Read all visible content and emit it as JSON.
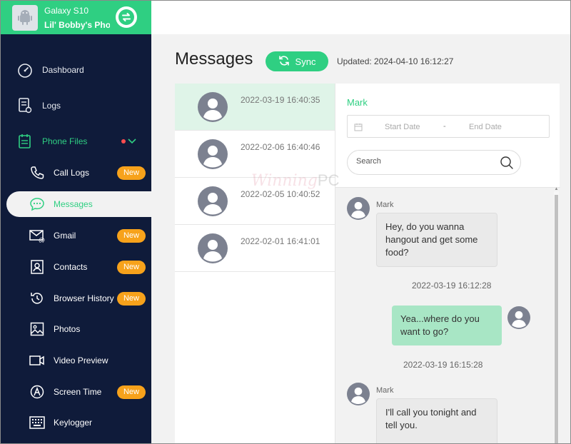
{
  "device": {
    "model": "Galaxy S10",
    "owner": "Lil' Bobby's Pho..."
  },
  "sidebar": {
    "dashboard": "Dashboard",
    "logs": "Logs",
    "phone_files": "Phone Files",
    "items": [
      {
        "label": "Call Logs",
        "badge": "New"
      },
      {
        "label": "Messages",
        "badge": ""
      },
      {
        "label": "Gmail",
        "badge": "New"
      },
      {
        "label": "Contacts",
        "badge": "New"
      },
      {
        "label": "Browser History",
        "badge": "New"
      },
      {
        "label": "Photos",
        "badge": ""
      },
      {
        "label": "Video Preview",
        "badge": ""
      },
      {
        "label": "Screen Time",
        "badge": "New"
      },
      {
        "label": "Keylogger",
        "badge": ""
      }
    ]
  },
  "header": {
    "title": "Messages",
    "sync_label": "Sync",
    "updated": "Updated: 2024-04-10 16:12:27"
  },
  "conversations": [
    {
      "time": "2022-03-19 16:40:35"
    },
    {
      "time": "2022-02-06 16:40:46"
    },
    {
      "time": "2022-02-05 10:40:52"
    },
    {
      "time": "2022-02-01 16:41:01"
    }
  ],
  "chat": {
    "contact": "Mark",
    "start_placeholder": "Start Date",
    "end_placeholder": "End Date",
    "date_sep": "-",
    "search_placeholder": "Search",
    "messages": [
      {
        "sender": "Mark",
        "text": "Hey, do you wanna hangout and get some food?",
        "time": "2022-03-19 16:12:28"
      },
      {
        "sender": "",
        "text": "Yea...where do you want to go?",
        "time": "2022-03-19 16:15:28"
      },
      {
        "sender": "Mark",
        "text": "I'll call you tonight and tell you.",
        "time": ""
      }
    ]
  },
  "watermark": {
    "a": "Winning",
    "b": "PC"
  },
  "colors": {
    "accent": "#2fcf82",
    "sidebar": "#0f1b3a",
    "badge": "#f7a21b"
  }
}
